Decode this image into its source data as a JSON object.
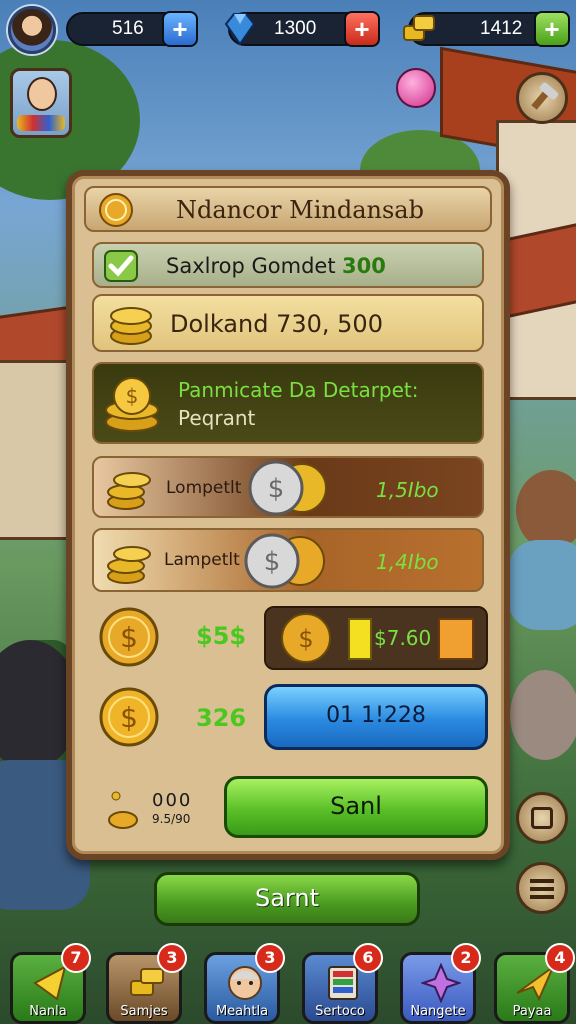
{
  "topbar": {
    "resources": [
      {
        "value": "516",
        "plus_icon": "plus-icon"
      },
      {
        "value": "1300",
        "plus_icon": "plus-icon"
      },
      {
        "value": "1412",
        "plus_icon": "plus-icon"
      }
    ]
  },
  "panel": {
    "title": "Ndancor Mindansab",
    "rows": {
      "check_row": {
        "label": "Saxlrop Gomdet",
        "value": "300"
      },
      "gold_row": {
        "label": "Dolkand 730, 500"
      },
      "payment_row": {
        "title": "Panmicate Da Detarpet:",
        "subtitle": "Peqrant"
      },
      "lampet_1": {
        "label": "Lompetlt",
        "value": "1,5Ibo"
      },
      "lampet_2": {
        "label": "Lampetlt",
        "value": "1,4Ibo"
      },
      "coin_row_1": {
        "left_value": "$5$",
        "right_value": "$7.60"
      },
      "coin_row_2": {
        "left_value": "326",
        "button_label": "01 1!228"
      },
      "send_row": {
        "count_top": "000",
        "count_bottom": "9.5/90",
        "button_label": "Sanl"
      }
    }
  },
  "start_button": "Sarnt",
  "bottom_nav": [
    {
      "label": "Nanla",
      "badge": "7",
      "icon": "flag-icon",
      "color": "#3f8a2a"
    },
    {
      "label": "Samjes",
      "badge": "3",
      "icon": "gold-bars-icon",
      "color": "#8a6a3a"
    },
    {
      "label": "Meahtla",
      "badge": "3",
      "icon": "grandpa-icon",
      "color": "#3a6ab0"
    },
    {
      "label": "Sertoco",
      "badge": "6",
      "icon": "album-icon",
      "color": "#3a5a9a"
    },
    {
      "label": "Nangete",
      "badge": "2",
      "icon": "star-icon",
      "color": "#4a6ac8"
    },
    {
      "label": "Payaa",
      "badge": "4",
      "icon": "glider-icon",
      "color": "#3f8a2a"
    }
  ],
  "colors": {
    "accent_green": "#6fd63a",
    "panel": "#d9bf92",
    "blue_button": "#2a8ae0"
  }
}
